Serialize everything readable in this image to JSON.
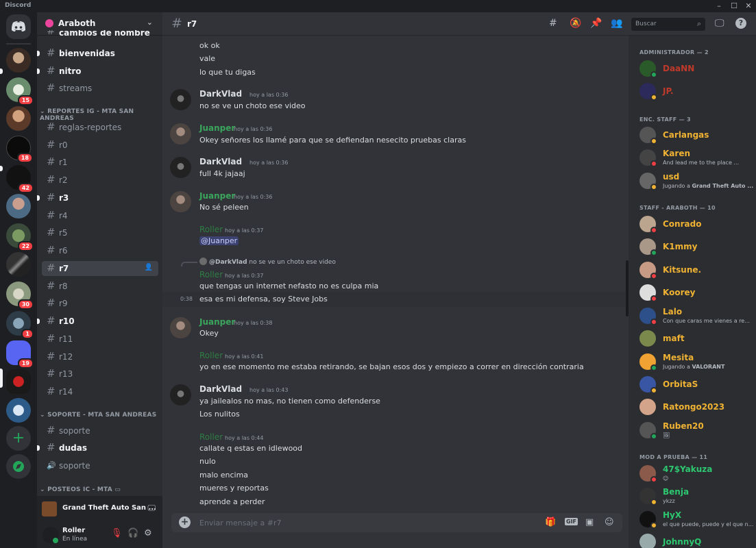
{
  "app": {
    "brand": "Discord"
  },
  "window_controls": {
    "minimize": "–",
    "maximize": "☐",
    "close": "✕"
  },
  "guilds": {
    "badges": [
      "15",
      "18",
      "42",
      "22",
      "30",
      "1",
      "19"
    ]
  },
  "server": {
    "name": "Araboth"
  },
  "sidebar": {
    "channels_top": [
      {
        "label": "cambios de nombre",
        "unread": true
      },
      {
        "label": "bienvenidas",
        "unread": true
      },
      {
        "label": "nitro",
        "unread": true
      },
      {
        "label": "streams",
        "unread": false
      }
    ],
    "category_reportes": "REPORTES IG - MTA SAN ANDREAS",
    "reportes": [
      {
        "label": "reglas-reportes",
        "unread": false
      },
      {
        "label": "r0",
        "unread": false
      },
      {
        "label": "r1",
        "unread": false
      },
      {
        "label": "r2",
        "unread": false
      },
      {
        "label": "r3",
        "unread": true
      },
      {
        "label": "r4",
        "unread": false
      },
      {
        "label": "r5",
        "unread": false
      },
      {
        "label": "r6",
        "unread": false
      },
      {
        "label": "r7",
        "unread": false,
        "active": true
      },
      {
        "label": "r8",
        "unread": false
      },
      {
        "label": "r9",
        "unread": false
      },
      {
        "label": "r10",
        "unread": true
      },
      {
        "label": "r11",
        "unread": false
      },
      {
        "label": "r12",
        "unread": false
      },
      {
        "label": "r13",
        "unread": false
      },
      {
        "label": "r14",
        "unread": false
      }
    ],
    "category_soporte": "SOPORTE - MTA SAN ANDREAS",
    "soporte": [
      {
        "label": "soporte",
        "unread": false,
        "type": "text"
      },
      {
        "label": "dudas",
        "unread": true,
        "type": "text"
      },
      {
        "label": "soporte",
        "unread": false,
        "type": "voice"
      }
    ],
    "category_posteos": "POSTEOS IC - MTA"
  },
  "activity": {
    "game": "Grand Theft Auto San ..."
  },
  "user": {
    "name": "Roller",
    "status": "En línea"
  },
  "channel": {
    "name": "r7"
  },
  "search": {
    "placeholder": "Buscar"
  },
  "messages": [
    {
      "text": "ok ok"
    },
    {
      "text": "vale"
    },
    {
      "text": "lo que tu digas"
    },
    {
      "author": "DarkVlad",
      "time": "hoy a las 0:36",
      "text": "no se ve un choto ese video"
    },
    {
      "author": "Juanper",
      "time": "hoy a las 0:36",
      "text": "Okey señores los llamé para que se defiendan nesecito pruebas claras"
    },
    {
      "author": "DarkVlad",
      "time": "hoy a las 0:36",
      "text": "full 4k jajaaj"
    },
    {
      "author": "Juanper",
      "time": "hoy a las 0:36",
      "text": "No sé peleen"
    },
    {
      "author": "Roller",
      "time": "hoy a las 0:37",
      "text": "@Juanper"
    },
    {
      "reply_author": "@DarkVlad",
      "reply_text": "no se ve un choto ese video",
      "author": "Roller",
      "time": "hoy a las 0:37",
      "text": "que tengas un internet nefasto no es culpa mia"
    },
    {
      "hover_time": "0:38",
      "text": "esa es mi defensa, soy Steve Jobs"
    },
    {
      "author": "Juanper",
      "time": "hoy a las 0:38",
      "text": "Okey"
    },
    {
      "author": "Roller",
      "time": "hoy a las 0:41",
      "text": "yo en ese momento me estaba retirando, se bajan esos dos y empiezo a correr en dirección contraria"
    },
    {
      "author": "DarkVlad",
      "time": "hoy a las 0:43",
      "text": "ya jailealos no mas, no tienen como defenderse"
    },
    {
      "text": "Los nulitos"
    },
    {
      "author": "Roller",
      "time": "hoy a las 0:44",
      "text": "callate q estas en idlewood"
    },
    {
      "text": "nulo"
    },
    {
      "text": "malo encima"
    },
    {
      "text": "mueres y reportas"
    },
    {
      "text": "aprende a perder"
    }
  ],
  "composer": {
    "placeholder": "Enviar mensaje a #r7",
    "gif": "GIF"
  },
  "members": {
    "categories": [
      "ADMINISTRADOR — 2",
      "ENC. STAFF — 3",
      "STAFF - ARABOTH — 10",
      "MOD A PRUEBA — 11"
    ],
    "list": [
      {
        "name": "DaaNN",
        "color": "#c0392b"
      },
      {
        "name": "JP.",
        "color": "#c0392b"
      },
      {
        "name": "Carlangas",
        "color": "#f0b232"
      },
      {
        "name": "Karen",
        "color": "#f0b232",
        "status": "And lead me to the place ..."
      },
      {
        "name": "usd",
        "color": "#f0b232",
        "status_prefix": "Jugando a ",
        "status_bold": "Grand Theft Auto ..."
      },
      {
        "name": "Conrado",
        "color": "#f0b232"
      },
      {
        "name": "K1mmy",
        "color": "#f0b232"
      },
      {
        "name": "Kitsune.",
        "color": "#f0b232"
      },
      {
        "name": "Koorey",
        "color": "#f0b232"
      },
      {
        "name": "Lalo",
        "color": "#f0b232",
        "status": "Con que caras me vienes a re..."
      },
      {
        "name": "maft",
        "color": "#f0b232"
      },
      {
        "name": "Mesita",
        "color": "#f0b232",
        "status_prefix": "Jugando a ",
        "status_bold": "VALORANT"
      },
      {
        "name": "OrbitaS",
        "color": "#f0b232"
      },
      {
        "name": "Ratongo2023",
        "color": "#f0b232"
      },
      {
        "name": "Ruben20",
        "color": "#f0b232"
      },
      {
        "name": "47$Yakuza",
        "color": "#2dc770"
      },
      {
        "name": "Benja",
        "color": "#2dc770",
        "status": "ykzz"
      },
      {
        "name": "HyX",
        "color": "#2dc770",
        "status": "el que puede, puede y el que n..."
      },
      {
        "name": "JohnnyQ",
        "color": "#2dc770"
      }
    ]
  },
  "colors": {
    "darkvlad": "#dbdee1",
    "juanper": "#3ba55c",
    "roller": "#2f7d43"
  }
}
